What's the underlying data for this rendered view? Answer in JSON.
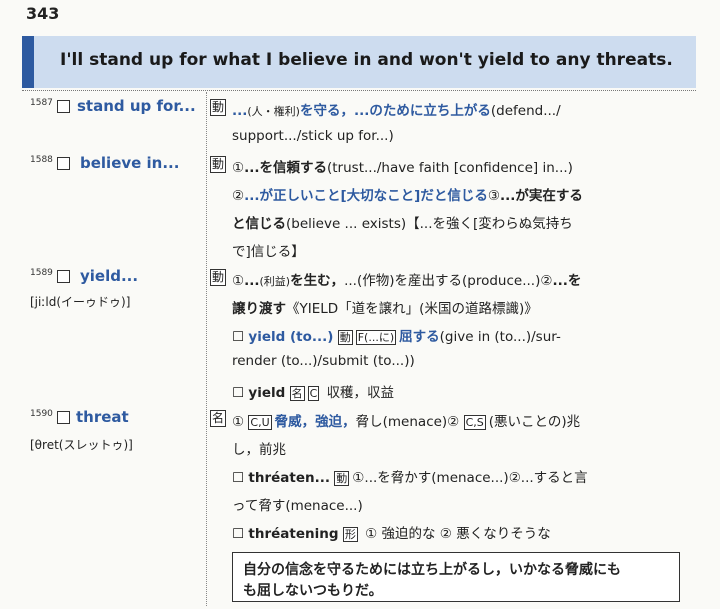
{
  "page_number": "343",
  "banner": "I'll stand up for what I believe in and won't yield to any threats.",
  "entries": [
    {
      "num": "1587",
      "head": "stand up for...",
      "pron": "",
      "pos": "動",
      "lines": [
        {
          "parts": [
            {
              "t": "...",
              "c": "blue"
            },
            {
              "t": "(人・権利)",
              "c": "sm"
            },
            {
              "t": "を守る，...のために立ち上がる",
              "c": "blue"
            },
            {
              "t": "(defend.../"
            }
          ]
        },
        {
          "parts": [
            {
              "t": "support.../stick up for...)"
            }
          ]
        }
      ]
    },
    {
      "num": "1588",
      "head": "believe in...",
      "pron": "",
      "pos": "動",
      "lines": [
        {
          "parts": [
            {
              "t": "①"
            },
            {
              "t": "...を信頼する",
              "c": "b"
            },
            {
              "t": "(trust.../have faith [confidence] in...)"
            }
          ]
        },
        {
          "parts": [
            {
              "t": "②"
            },
            {
              "t": "...が正しいこと[大切なこと]だと信じる",
              "c": "blue"
            },
            {
              "t": "③"
            },
            {
              "t": "...が実在する",
              "c": "b"
            }
          ]
        },
        {
          "parts": [
            {
              "t": "と信じる",
              "c": "b"
            },
            {
              "t": "(believe ... exists)"
            },
            {
              "t": "【...を強く[変わらぬ気持ち"
            }
          ]
        },
        {
          "parts": [
            {
              "t": "で]信じる】"
            }
          ]
        }
      ]
    },
    {
      "num": "1589",
      "head": "yield...",
      "pron": "[jiːld(イーゥドゥ)]",
      "pos": "動",
      "lines": [
        {
          "parts": [
            {
              "t": "①"
            },
            {
              "t": "...",
              "c": "b"
            },
            {
              "t": "(利益)",
              "c": "sm"
            },
            {
              "t": "を生む，",
              "c": "b"
            },
            {
              "t": "...(作物)を産出する(produce...)"
            },
            {
              "t": "②"
            },
            {
              "t": "...を",
              "c": "b"
            }
          ]
        },
        {
          "parts": [
            {
              "t": "譲り渡す",
              "c": "b"
            },
            {
              "t": "《YIELD「道を譲れ」(米国の道路標識)》"
            }
          ]
        }
      ]
    },
    {
      "num": "1590",
      "head": "threat",
      "pron": "[θret(スレットゥ)]",
      "pos": "名",
      "lines": []
    }
  ],
  "sub": {
    "yield_to": {
      "label": "yield (to...)",
      "pos": "動",
      "tag": "F(...に)",
      "meaning": "屈する",
      "rest": "(give in (to...)/sur-",
      "line2": "render (to...)/submit (to...))"
    },
    "yield_n": {
      "label": "yield",
      "pos": "名",
      "tag": "C",
      "meaning": "収穫，収益"
    },
    "threat_line1": {
      "circ": "①",
      "tag": "C,U",
      "meaning": "脅威，強迫，",
      "rest": "脅し(menace)②",
      "tag2": "C,S",
      "rest2": "(悪いことの)兆"
    },
    "threat_line2": "し，前兆",
    "threaten": {
      "label": "thréaten...",
      "pos": "動",
      "rest": "①...を脅かす(menace...)②...すると言"
    },
    "threaten_line2": "って脅す(menace...)",
    "threatening": {
      "label": "thréatening",
      "pos": "形",
      "rest": "① 強迫的な ② 悪くなりそうな"
    }
  },
  "summary_box": [
    "自分の信念を守るためには立ち上がるし，いかなる脅威にも",
    "も屈しないつもりだ。"
  ]
}
